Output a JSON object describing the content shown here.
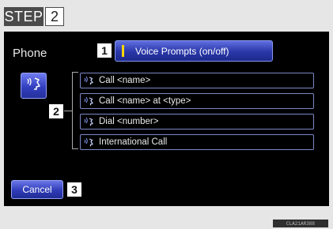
{
  "step": {
    "label": "STEP",
    "number": "2"
  },
  "screen": {
    "title": "Phone",
    "voice_prompts_button": {
      "callout": "1",
      "label": "Voice Prompts (on/off)"
    },
    "commands_callout": "2",
    "commands": [
      {
        "label": "Call <name>"
      },
      {
        "label": "Call <name> at <type>"
      },
      {
        "label": "Dial <number>"
      },
      {
        "label": "International Call"
      }
    ],
    "cancel_button": {
      "label": "Cancel",
      "callout": "3"
    }
  },
  "image_code": "CLA21AR388",
  "colors": {
    "screen_bg": "#000000",
    "button_blue": "#2f3cb8",
    "outline_blue": "#7c88c6",
    "accent_yellow": "#ffd800"
  },
  "icons": {
    "mic": "voice-command-icon",
    "command": "voice-command-small-icon"
  }
}
